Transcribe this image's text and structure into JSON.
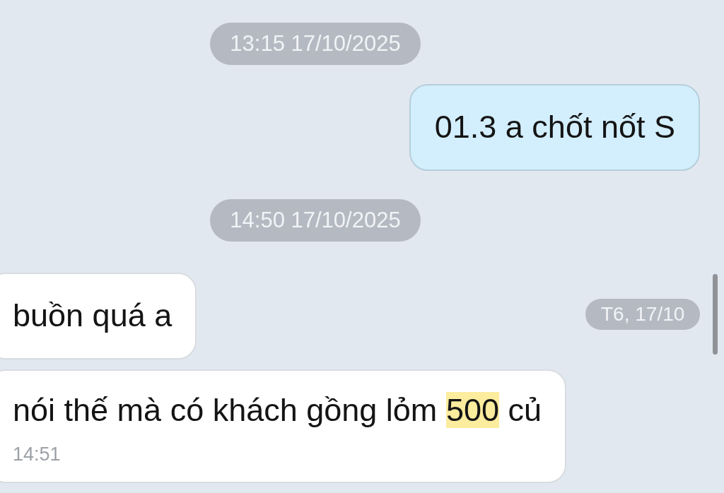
{
  "messages": [
    {
      "kind": "time_divider",
      "text": "13:15 17/10/2025"
    },
    {
      "kind": "outgoing",
      "segments": [
        {
          "text": "01.3 a chốt nốt S",
          "highlighted": false
        }
      ]
    },
    {
      "kind": "time_divider",
      "text": "14:50 17/10/2025"
    },
    {
      "kind": "incoming",
      "segments": [
        {
          "text": "buồn quá a",
          "highlighted": false
        }
      ]
    },
    {
      "kind": "incoming",
      "segments": [
        {
          "text": "nói thế mà có khách gồng lỏm ",
          "highlighted": false
        },
        {
          "text": "500",
          "highlighted": true
        },
        {
          "text": " củ",
          "highlighted": false
        }
      ],
      "time": "14:51"
    }
  ],
  "floating_date": "T6, 17/10"
}
